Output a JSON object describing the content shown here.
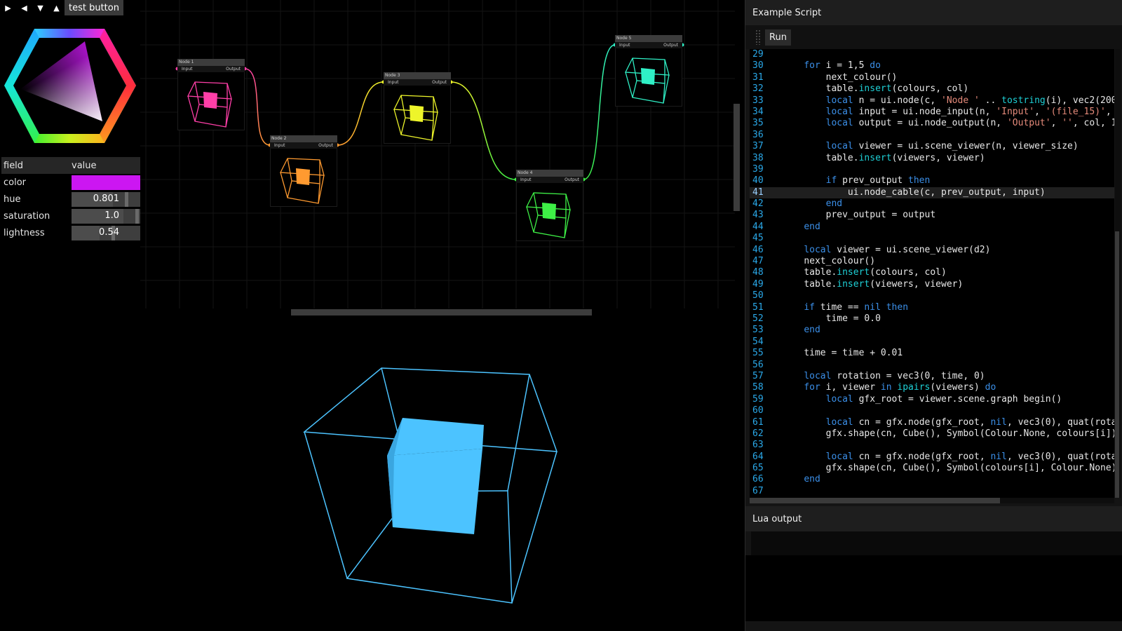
{
  "toolbar": {
    "buttons": [
      {
        "name": "play-icon",
        "glyph": "▶"
      },
      {
        "name": "back-icon",
        "glyph": "◀"
      },
      {
        "name": "down-icon",
        "glyph": "▼"
      },
      {
        "name": "up-icon",
        "glyph": "▲"
      }
    ],
    "test_button": "test button"
  },
  "properties": {
    "header": {
      "field": "field",
      "value": "value"
    },
    "color": {
      "label": "color",
      "value": "#cc16f2"
    },
    "hue": {
      "label": "hue",
      "value": "0.801",
      "fraction": 0.801
    },
    "saturation": {
      "label": "saturation",
      "value": "1.0",
      "fraction": 1.0
    },
    "lightness": {
      "label": "lightness",
      "value": "0.54",
      "fraction": 0.54
    }
  },
  "graph": {
    "port_in": "Input",
    "port_out": "Output",
    "nodes": [
      {
        "title": "Node 1",
        "color": "#ff3fa8"
      },
      {
        "title": "Node 2",
        "color": "#ff9a30"
      },
      {
        "title": "Node 3",
        "color": "#eef52a"
      },
      {
        "title": "Node 4",
        "color": "#3ef046"
      },
      {
        "title": "Node 5",
        "color": "#2ff0c6"
      }
    ]
  },
  "viewer": {
    "color": "#4cc3ff"
  },
  "script_panel": {
    "title": "Example Script",
    "run_label": "Run",
    "current_line": 41,
    "lines": [
      {
        "n": "29",
        "t": ""
      },
      {
        "n": "30",
        "t": "    for i = 1,5 do"
      },
      {
        "n": "31",
        "t": "        next_colour()"
      },
      {
        "n": "32",
        "t": "        table.insert(colours, col)"
      },
      {
        "n": "33",
        "t": "        local n = ui.node(c, 'Node ' .. tostring(i), vec2(200"
      },
      {
        "n": "34",
        "t": "        local input = ui.node_input(n, 'Input', '(file_15)',"
      },
      {
        "n": "35",
        "t": "        local output = ui.node_output(n, 'Output', '', col, 1"
      },
      {
        "n": "36",
        "t": ""
      },
      {
        "n": "37",
        "t": "        local viewer = ui.scene_viewer(n, viewer_size)"
      },
      {
        "n": "38",
        "t": "        table.insert(viewers, viewer)"
      },
      {
        "n": "39",
        "t": ""
      },
      {
        "n": "40",
        "t": "        if prev_output then"
      },
      {
        "n": "41",
        "t": "            ui.node_cable(c, prev_output, input)"
      },
      {
        "n": "42",
        "t": "        end"
      },
      {
        "n": "43",
        "t": "        prev_output = output"
      },
      {
        "n": "44",
        "t": "    end"
      },
      {
        "n": "45",
        "t": ""
      },
      {
        "n": "46",
        "t": "    local viewer = ui.scene_viewer(d2)"
      },
      {
        "n": "47",
        "t": "    next_colour()"
      },
      {
        "n": "48",
        "t": "    table.insert(colours, col)"
      },
      {
        "n": "49",
        "t": "    table.insert(viewers, viewer)"
      },
      {
        "n": "50",
        "t": ""
      },
      {
        "n": "51",
        "t": "    if time == nil then"
      },
      {
        "n": "52",
        "t": "        time = 0.0"
      },
      {
        "n": "53",
        "t": "    end"
      },
      {
        "n": "54",
        "t": ""
      },
      {
        "n": "55",
        "t": "    time = time + 0.01"
      },
      {
        "n": "56",
        "t": ""
      },
      {
        "n": "57",
        "t": "    local rotation = vec3(0, time, 0)"
      },
      {
        "n": "58",
        "t": "    for i, viewer in ipairs(viewers) do"
      },
      {
        "n": "59",
        "t": "        local gfx_root = viewer.scene.graph begin()"
      },
      {
        "n": "60",
        "t": ""
      },
      {
        "n": "61",
        "t": "        local cn = gfx.node(gfx_root, nil, vec3(0), quat(rota"
      },
      {
        "n": "62",
        "t": "        gfx.shape(cn, Cube(), Symbol(Colour.None, colours[i])"
      },
      {
        "n": "63",
        "t": ""
      },
      {
        "n": "64",
        "t": "        local cn = gfx.node(gfx_root, nil, vec3(0), quat(rota"
      },
      {
        "n": "65",
        "t": "        gfx.shape(cn, Cube(), Symbol(colours[i], Colour.None)"
      },
      {
        "n": "66",
        "t": "    end"
      },
      {
        "n": "67",
        "t": ""
      }
    ]
  },
  "lua_output": {
    "title": "Lua output",
    "text": ""
  }
}
